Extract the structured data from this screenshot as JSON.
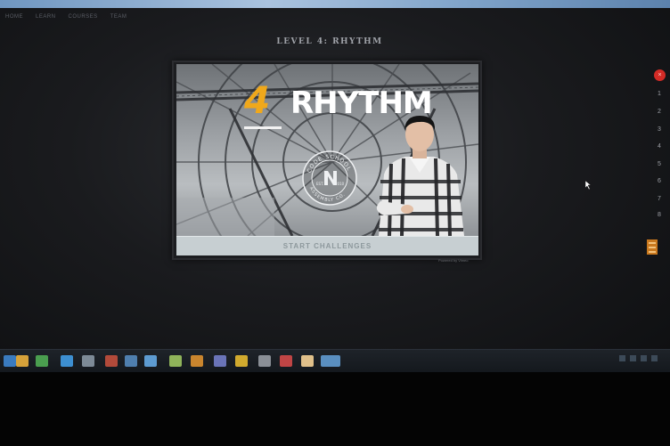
{
  "app_nav": {
    "items": [
      "Home",
      "Learn",
      "Courses",
      "Team"
    ]
  },
  "level_title": "LEVEL 4: RHYTHM",
  "video": {
    "level_number": "4",
    "heading": "RHYTHM",
    "seal_text": "CODE SCHOOL",
    "seal_bottom": "ASSEMBLY CO.",
    "seal_est": "EST.",
    "seal_year": "2010"
  },
  "start_button": "START CHALLENGES",
  "powered_by": "Powered by Vimeo",
  "side_nav": {
    "close_glyph": "×",
    "items": [
      "1",
      "2",
      "3",
      "4",
      "5",
      "6",
      "7",
      "8"
    ]
  },
  "colors": {
    "accent": "#f0a81b",
    "close": "#d32b26",
    "menu": "#c9781e",
    "start_bg": "#c7cfd2"
  },
  "taskbar": {
    "icons": [
      "explorer-icon",
      "folder-icon",
      "chrome-icon",
      "media-icon",
      "app-icon",
      "app-icon",
      "app-icon",
      "app-icon",
      "app-icon",
      "app-icon",
      "app-icon",
      "app-icon",
      "app-icon",
      "app-icon",
      "app-icon",
      "app-icon"
    ]
  }
}
